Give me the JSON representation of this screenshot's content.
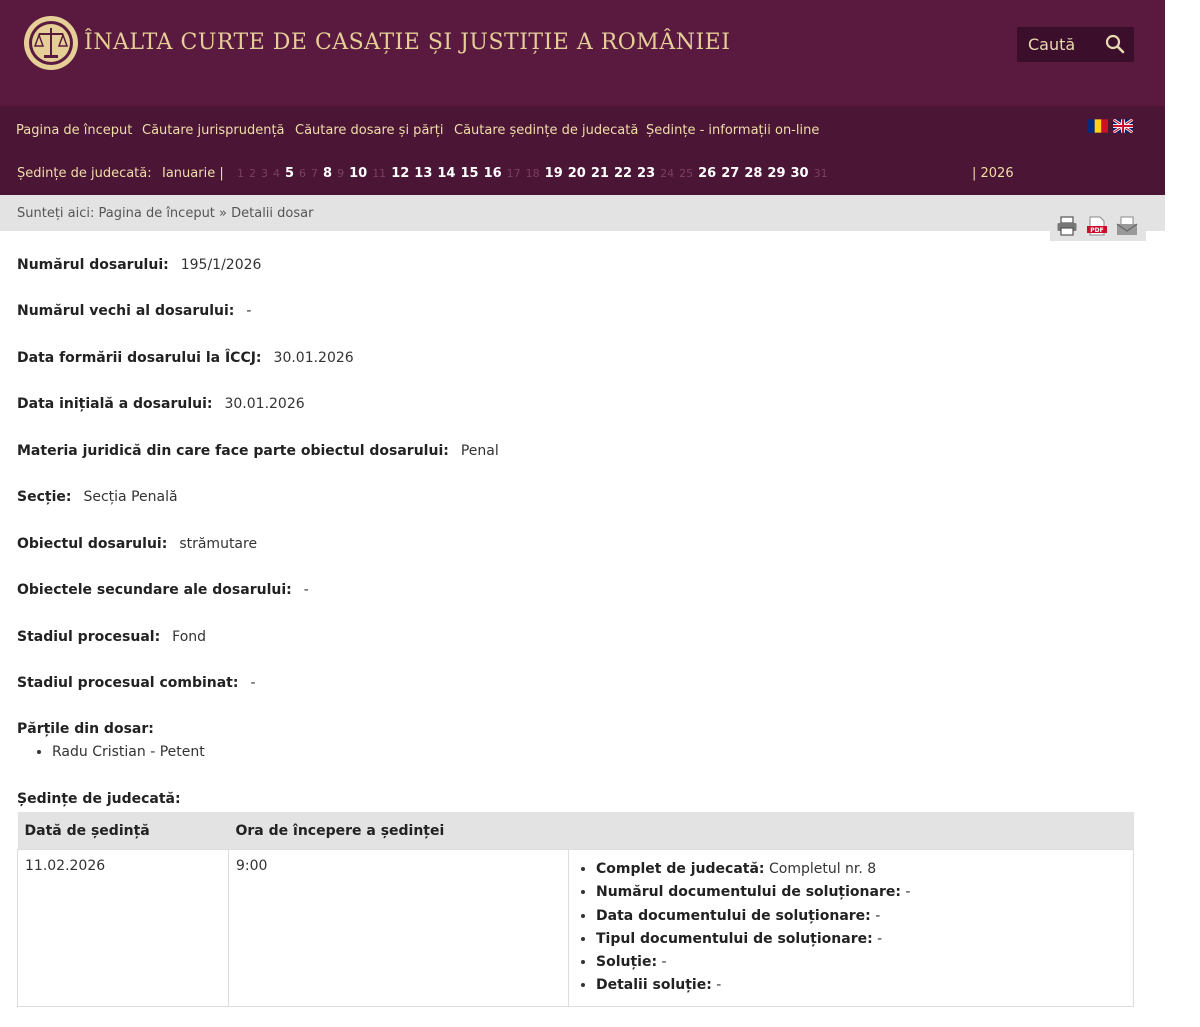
{
  "header": {
    "title": "ÎNALTA CURTE DE CASAȚIE ȘI JUSTIȚIE A ROMÂNIEI",
    "search_label": "Caută",
    "logo": "scales-of-justice-seal"
  },
  "nav": {
    "items": [
      "Pagina de început",
      "Căutare jurisprudență",
      "Căutare dosare și părți",
      "Căutare ședințe de judecată",
      "Ședințe - informații on-line"
    ],
    "flags": [
      "romania-flag-icon",
      "uk-flag-icon"
    ]
  },
  "sessions_bar": {
    "label": "Ședințe de judecată:",
    "month": "Ianuarie |",
    "days": [
      {
        "d": "1",
        "s": "i"
      },
      {
        "d": "2",
        "s": "i"
      },
      {
        "d": "3",
        "s": "i"
      },
      {
        "d": "4",
        "s": "i"
      },
      {
        "d": "5",
        "s": "a"
      },
      {
        "d": "6",
        "s": "i"
      },
      {
        "d": "7",
        "s": "i"
      },
      {
        "d": "8",
        "s": "a"
      },
      {
        "d": "9",
        "s": "i"
      },
      {
        "d": "10",
        "s": "a"
      },
      {
        "d": "11",
        "s": "i"
      },
      {
        "d": "12",
        "s": "a"
      },
      {
        "d": "13",
        "s": "a"
      },
      {
        "d": "14",
        "s": "a"
      },
      {
        "d": "15",
        "s": "a"
      },
      {
        "d": "16",
        "s": "a"
      },
      {
        "d": "17",
        "s": "i"
      },
      {
        "d": "18",
        "s": "i"
      },
      {
        "d": "19",
        "s": "a"
      },
      {
        "d": "20",
        "s": "a"
      },
      {
        "d": "21",
        "s": "a"
      },
      {
        "d": "22",
        "s": "a"
      },
      {
        "d": "23",
        "s": "a"
      },
      {
        "d": "24",
        "s": "i"
      },
      {
        "d": "25",
        "s": "i"
      },
      {
        "d": "26",
        "s": "a"
      },
      {
        "d": "27",
        "s": "a"
      },
      {
        "d": "28",
        "s": "a"
      },
      {
        "d": "29",
        "s": "a"
      },
      {
        "d": "30",
        "s": "c"
      },
      {
        "d": "31",
        "s": "i"
      }
    ],
    "year": "| 2026"
  },
  "breadcrumb": {
    "text": "Sunteți aici: Pagina de început » Detalii dosar"
  },
  "tools": [
    "print-icon",
    "pdf-icon",
    "email-icon"
  ],
  "details": [
    {
      "label": "Numărul dosarului:",
      "value": "195/1/2026"
    },
    {
      "label": "Numărul vechi al dosarului:",
      "value": "-"
    },
    {
      "label": "Data formării dosarului la ÎCCJ:",
      "value": "30.01.2026"
    },
    {
      "label": "Data inițială a dosarului:",
      "value": "30.01.2026"
    },
    {
      "label": "Materia juridică din care face parte obiectul dosarului:",
      "value": "Penal"
    },
    {
      "label": "Secție:",
      "value": "Secția Penală"
    },
    {
      "label": "Obiectul dosarului:",
      "value": "strămutare"
    },
    {
      "label": "Obiectele secundare ale dosarului:",
      "value": "-"
    },
    {
      "label": "Stadiul procesual:",
      "value": "Fond"
    },
    {
      "label": "Stadiul procesual combinat:",
      "value": "-"
    }
  ],
  "parties": {
    "label": "Părțile din dosar:",
    "items": [
      "Radu Cristian - Petent"
    ]
  },
  "sessions": {
    "label": "Ședințe de judecată:",
    "headers": [
      "Dată de ședință",
      "Ora de începere a ședinței",
      ""
    ],
    "rows": [
      {
        "date": "11.02.2026",
        "time": "9:00",
        "info": [
          {
            "label": "Complet de judecată:",
            "value": "Completul nr. 8"
          },
          {
            "label": "Numărul documentului de soluționare:",
            "value": "-"
          },
          {
            "label": "Data documentului de soluționare:",
            "value": "-"
          },
          {
            "label": "Tipul documentului de soluționare:",
            "value": "-"
          },
          {
            "label": "Soluție:",
            "value": "-"
          },
          {
            "label": "Detalii soluție:",
            "value": "-"
          }
        ]
      }
    ]
  }
}
